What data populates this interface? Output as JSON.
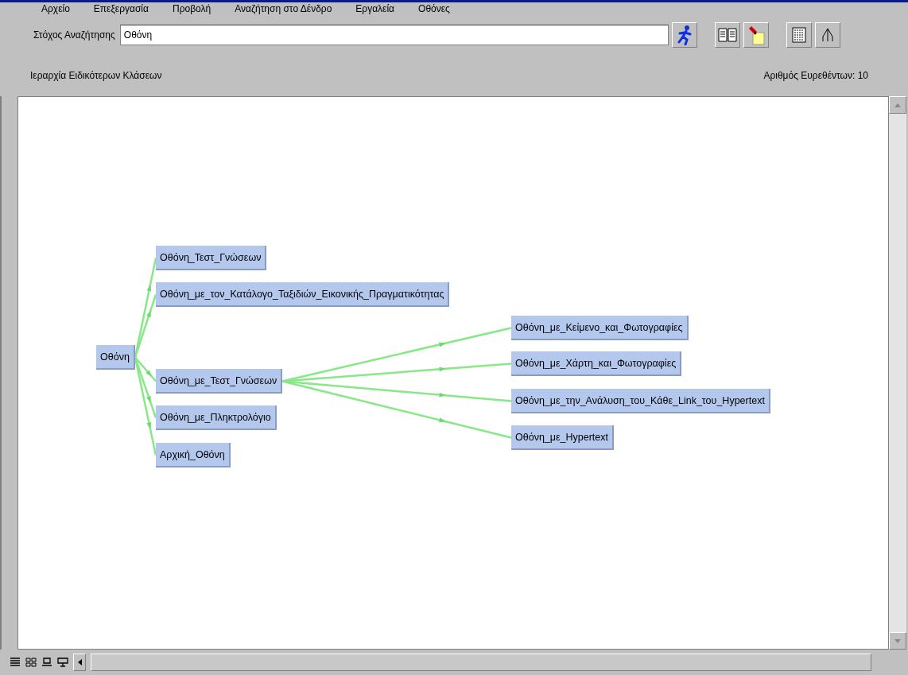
{
  "menu": [
    "Αρχείο",
    "Επεξεργασία",
    "Προβολή",
    "Αναζήτηση στο Δένδρο",
    "Εργαλεία",
    "Οθόνες"
  ],
  "search": {
    "label": "Στόχος Αναζήτησης",
    "value": "Οθόνη"
  },
  "hierarchy_title": "Ιεραρχία Ειδικότερων Κλάσεων",
  "results_count": "Αριθμός Ευρεθέντων: 10",
  "tree": {
    "label": "Οθόνη",
    "children": [
      {
        "label": "Οθόνη_Τεστ_Γνώσεων"
      },
      {
        "label": "Οθόνη_με_τον_Κατάλογο_Ταξιδιών_Εικονικής_Πραγματικότητας"
      },
      {
        "label": "Οθόνη_με_Τεστ_Γνώσεων",
        "children": [
          {
            "label": "Οθόνη_με_Κείμενο_και_Φωτογραφίες"
          },
          {
            "label": "Οθόνη_με_Χάρτη_και_Φωτογραφίες"
          },
          {
            "label": "Οθόνη_με_την_Ανάλυση_του_Κάθε_Link_του_Hypertext"
          },
          {
            "label": "Οθόνη_με_Hypertext"
          }
        ]
      },
      {
        "label": "Οθόνη_με_Πληκτρολόγιο"
      },
      {
        "label": "Αρχική_Οθόνη"
      }
    ]
  }
}
